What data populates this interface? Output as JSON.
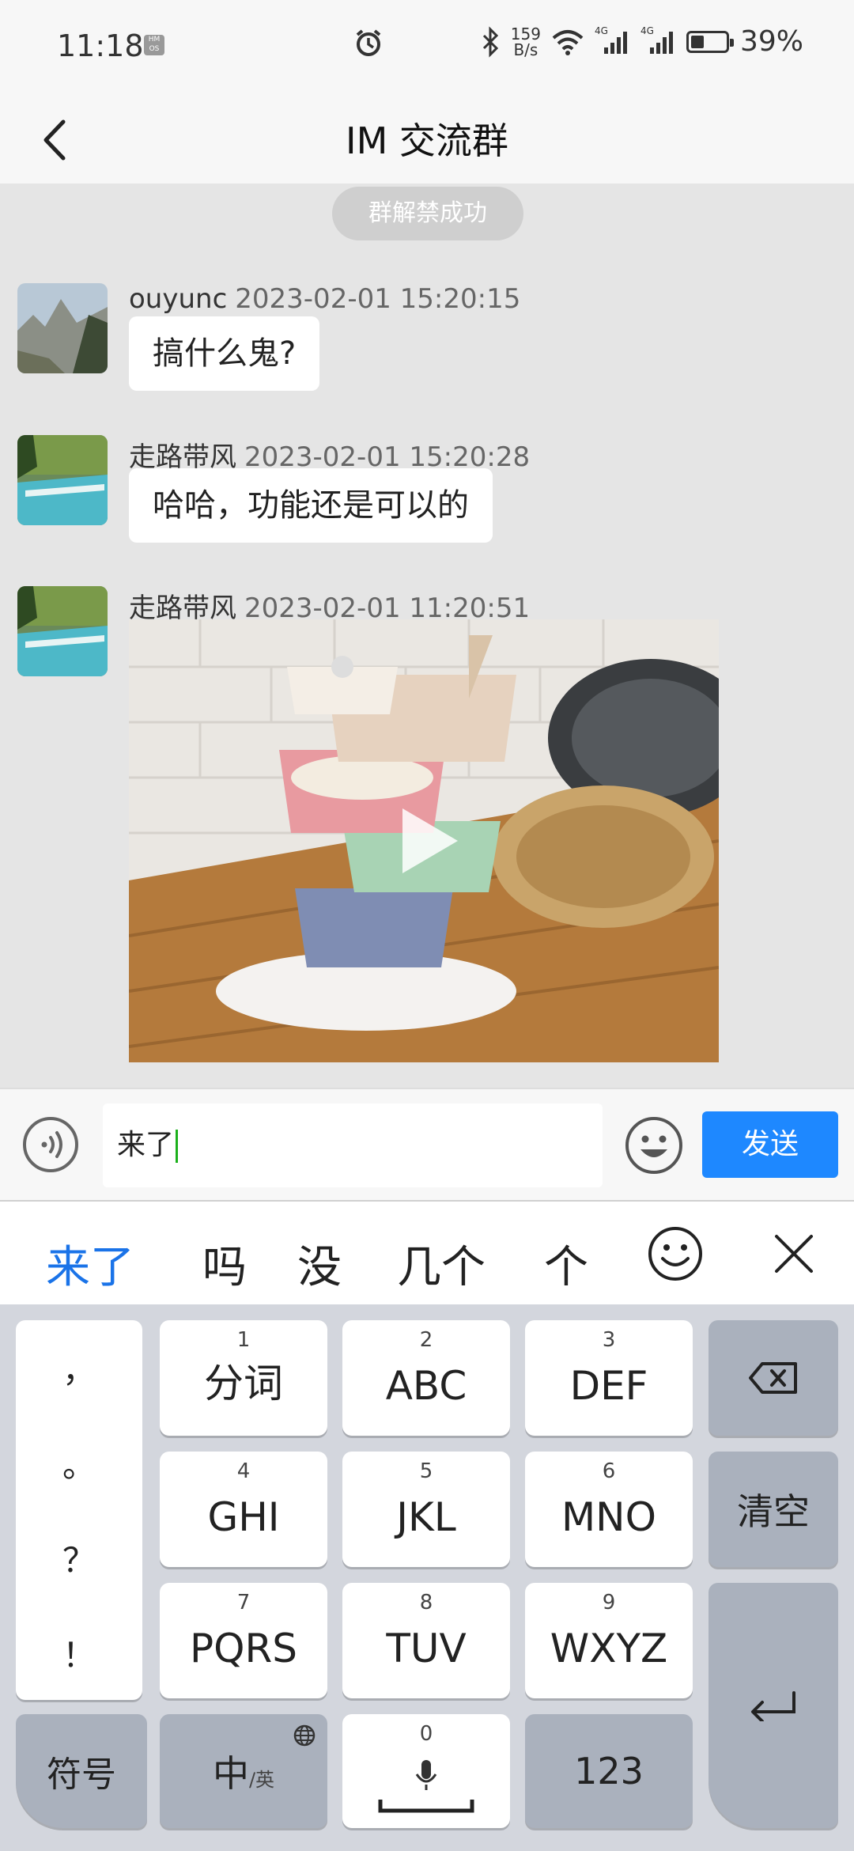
{
  "status_bar": {
    "time": "11:18",
    "hmos_badge": "HM OS",
    "net_speed_value": "159",
    "net_speed_unit": "B/s",
    "network_1": "4G",
    "network_2": "4G",
    "battery_percent": "39%",
    "battery_level": 0.39
  },
  "header": {
    "title": "IM 交流群"
  },
  "chat": {
    "system_notice": "群解禁成功",
    "messages": [
      {
        "sender": "ouyunc",
        "time": "2023-02-01 15:20:15",
        "text": "搞什么鬼?"
      },
      {
        "sender": "走路带风",
        "time": "2023-02-01 15:20:28",
        "text": "哈哈，功能还是可以的"
      },
      {
        "sender": "走路带风",
        "time": "2023-02-01 11:20:51",
        "media": "video"
      }
    ]
  },
  "input_bar": {
    "text_value": "来了",
    "send_label": "发送"
  },
  "suggestions": {
    "items": [
      "来了",
      "吗",
      "没",
      "几个",
      "个"
    ]
  },
  "keyboard": {
    "punctuation": [
      "，",
      "。",
      "？",
      "！"
    ],
    "keys": [
      {
        "num": "1",
        "label": "分词"
      },
      {
        "num": "2",
        "label": "ABC"
      },
      {
        "num": "3",
        "label": "DEF"
      },
      {
        "num": "4",
        "label": "GHI"
      },
      {
        "num": "5",
        "label": "JKL"
      },
      {
        "num": "6",
        "label": "MNO"
      },
      {
        "num": "7",
        "label": "PQRS"
      },
      {
        "num": "8",
        "label": "TUV"
      },
      {
        "num": "9",
        "label": "WXYZ"
      }
    ],
    "clear_label": "清空",
    "symbol_label": "符号",
    "lang_label": "中",
    "lang_sub": "/英",
    "space_num": "0",
    "num_label": "123"
  }
}
